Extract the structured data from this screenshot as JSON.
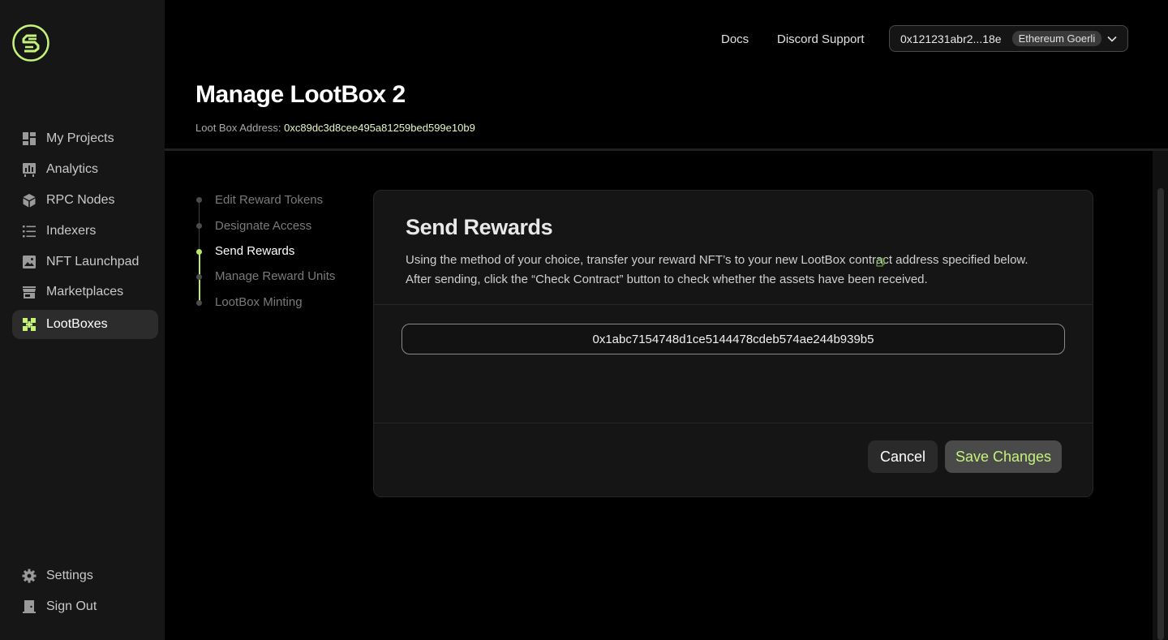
{
  "sidebar": {
    "logo_icon": "brand-logo-icon",
    "items": [
      {
        "label": "My Projects",
        "icon": "grid-icon"
      },
      {
        "label": "Analytics",
        "icon": "chart-icon"
      },
      {
        "label": "RPC Nodes",
        "icon": "cube-icon"
      },
      {
        "label": "Indexers",
        "icon": "list-icon"
      },
      {
        "label": "NFT Launchpad",
        "icon": "image-icon"
      },
      {
        "label": "Marketplaces",
        "icon": "store-icon"
      },
      {
        "label": "LootBoxes",
        "icon": "lootbox-icon",
        "active": true
      }
    ],
    "bottom": [
      {
        "label": "Settings",
        "icon": "gear-icon"
      },
      {
        "label": "Sign Out",
        "icon": "signout-icon"
      }
    ]
  },
  "header": {
    "docs": "Docs",
    "discord": "Discord Support",
    "wallet": "0x121231abr2...18e",
    "network": "Ethereum Goerli"
  },
  "page": {
    "title": "Manage LootBox 2",
    "address_label": "Loot Box Address:",
    "address_value": "0xc89dc3d8cee495a81259bed599e10b9"
  },
  "steps": [
    {
      "label": "Edit Reward Tokens",
      "active": false
    },
    {
      "label": "Designate Access",
      "active": false
    },
    {
      "label": "Send Rewards",
      "active": true
    },
    {
      "label": "Manage Reward Units",
      "active": false
    },
    {
      "label": "LootBox Minting",
      "active": false
    }
  ],
  "card": {
    "title": "Send Rewards",
    "desc_line1": "Using the method of your choice, transfer your reward NFT’s to your new LootBox contract address specified below.",
    "desc_line2": "After sending, click the “Check Contract” button to check whether the assets have been received.",
    "contract_address": "0x1abc7154748d1ce5144478cdeb574ae244b939b5",
    "cancel_label": "Cancel",
    "save_label": "Save Changes"
  },
  "colors": {
    "accent": "#c4f27a",
    "background": "#000000",
    "sidebar": "#161616",
    "card": "#151515"
  }
}
